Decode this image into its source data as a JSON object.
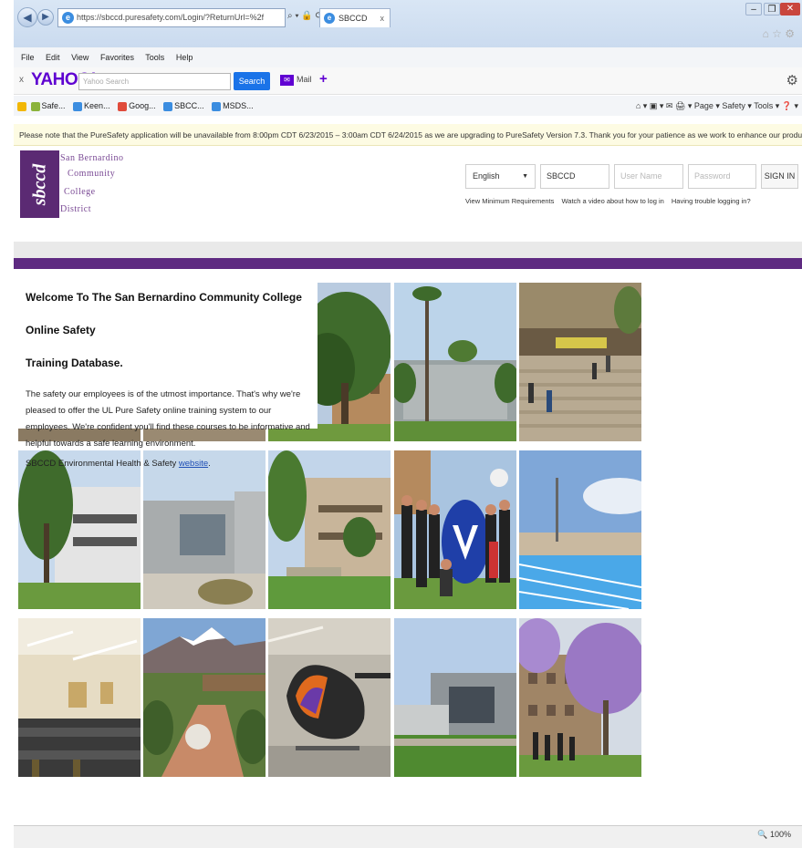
{
  "browser": {
    "address": "https://sbccd.puresafety.com/Login/?ReturnUrl=%2f",
    "addr_tools": "⌕ ▾ 🔒 ⟳",
    "tab_title": "SBCCD",
    "tab_close": "x",
    "menu": [
      "File",
      "Edit",
      "View",
      "Favorites",
      "Tools",
      "Help"
    ],
    "yahoo": {
      "close": "x",
      "logo": "YAHOO!",
      "placeholder": "Yahoo Search",
      "search_label": "Search",
      "mail_label": "Mail",
      "plus": "+"
    },
    "favorites": [
      "Safe...",
      "Keen...",
      "Goog...",
      "SBCC...",
      "MSDS..."
    ],
    "command_bar": "⌂ ▾  ▣ ▾  ✉  🖨 ▾  Page ▾  Safety ▾  Tools ▾  ❓ ▾",
    "zoom": "🔍 100%"
  },
  "notice": "Please note that the PureSafety application will be unavailable from 8:00pm CDT 6/23/2015 – 3:00am CDT 6/24/2015 as we are upgrading to PureSafety Version 7.3. Thank you for your patience as we work to enhance our product.",
  "logo": {
    "mark": "sbccd",
    "line1": "San Bernardino",
    "line2": "Community",
    "line3": "College",
    "line4": "District"
  },
  "login": {
    "language": "English",
    "company": "SBCCD",
    "username_placeholder": "User Name",
    "password_placeholder": "Password",
    "signin_label": "SIGN IN",
    "links": [
      "View Minimum Requirements",
      "Watch a video about how to log in",
      "Having trouble logging in?"
    ]
  },
  "welcome": {
    "title_line1": "Welcome To The San Bernardino Community College Online Safety",
    "title_line2": "Training Database.",
    "body": "The safety our employees is of the utmost importance. That's why we're pleased to offer the UL Pure Safety online training system to our employees. We're confident you'll find these courses to be informative and helpful towards a safe learning environment.",
    "footer_text": "SBCCD Environmental Health & Safety ",
    "footer_link": "website",
    "footer_end": "."
  },
  "colors": {
    "brand_purple": "#5e2a81",
    "notice_bg": "#fdfbe3",
    "yahoo_purple": "#5f01d1",
    "search_blue": "#1a73e8"
  }
}
